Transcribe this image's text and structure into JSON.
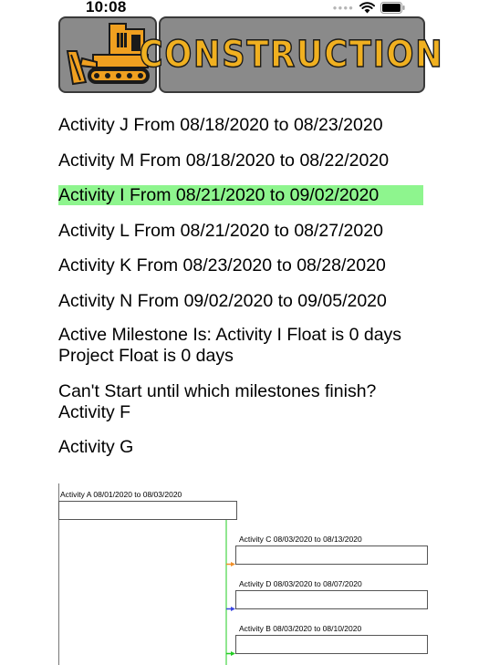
{
  "status_bar": {
    "time": "10:08"
  },
  "header": {
    "title": "CONSTRUCTION",
    "logo_icon": "bulldozer-icon",
    "title_color": "#f0b020"
  },
  "activities": [
    {
      "text": "Activity J From 08/18/2020 to 08/23/2020",
      "highlighted": false
    },
    {
      "text": "Activity M From 08/18/2020 to 08/22/2020",
      "highlighted": false
    },
    {
      "text": "Activity I From 08/21/2020 to 09/02/2020",
      "highlighted": true
    },
    {
      "text": "Activity L From 08/21/2020 to 08/27/2020",
      "highlighted": false
    },
    {
      "text": "Activity K From 08/23/2020 to 08/28/2020",
      "highlighted": false
    },
    {
      "text": "Activity N From 09/02/2020 to 09/05/2020",
      "highlighted": false
    }
  ],
  "highlight_color": "#8ef58e",
  "milestone": {
    "active_line": "Active Milestone Is: Activity I  Float is 0 days",
    "project_float": "Project Float is 0 days"
  },
  "predecessors": {
    "question": "Can't Start until which milestones finish?",
    "items": [
      "Activity F",
      "Activity G"
    ]
  },
  "gantt": {
    "tasks": [
      {
        "label": "Activity A 08/01/2020 to 08/03/2020"
      },
      {
        "label": "Activity C 08/03/2020 to 08/13/2020",
        "arrow_color": "#f0902a"
      },
      {
        "label": "Activity D 08/03/2020 to 08/07/2020",
        "arrow_color": "#3a46e0"
      },
      {
        "label": "Activity B 08/03/2020 to 08/10/2020",
        "arrow_color": "#22cc22"
      }
    ],
    "connector_color": "#22cc22"
  }
}
